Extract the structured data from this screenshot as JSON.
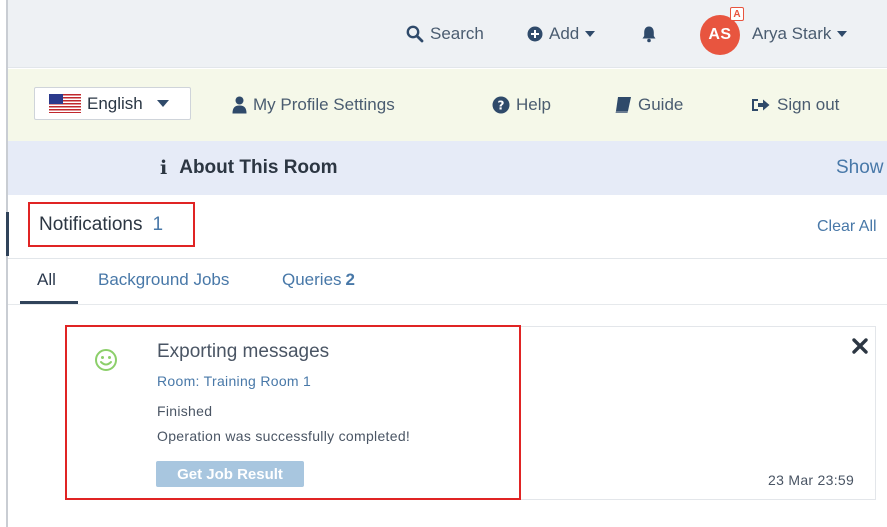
{
  "topbar": {
    "search_label": "Search",
    "add_label": "Add",
    "user": {
      "initials": "AS",
      "badge": "A",
      "name": "Arya Stark",
      "avatar_color": "#e8553f"
    }
  },
  "toolbar": {
    "language": "English",
    "profile_label": "My Profile Settings",
    "help_label": "Help",
    "guide_label": "Guide",
    "signout_label": "Sign out"
  },
  "about": {
    "title": "About This Room",
    "show_label": "Show"
  },
  "notifications": {
    "label": "Notifications",
    "count": "1",
    "clear_all": "Clear All",
    "tabs": [
      {
        "label": "All",
        "count": "",
        "active": true
      },
      {
        "label": "Background Jobs",
        "count": "",
        "active": false
      },
      {
        "label": "Queries",
        "count": "2",
        "active": false
      }
    ],
    "items": [
      {
        "title": "Exporting messages",
        "room": "Room: Training Room 1",
        "status": "Finished",
        "message": "Operation was successfully completed!",
        "action_label": "Get Job Result",
        "time": "23 Mar 23:59",
        "icon": "smiley-icon"
      }
    ]
  },
  "colors": {
    "highlight": "#e02424",
    "link": "#4878a8",
    "success": "#8ccf6a",
    "button": "#a8c6df"
  }
}
